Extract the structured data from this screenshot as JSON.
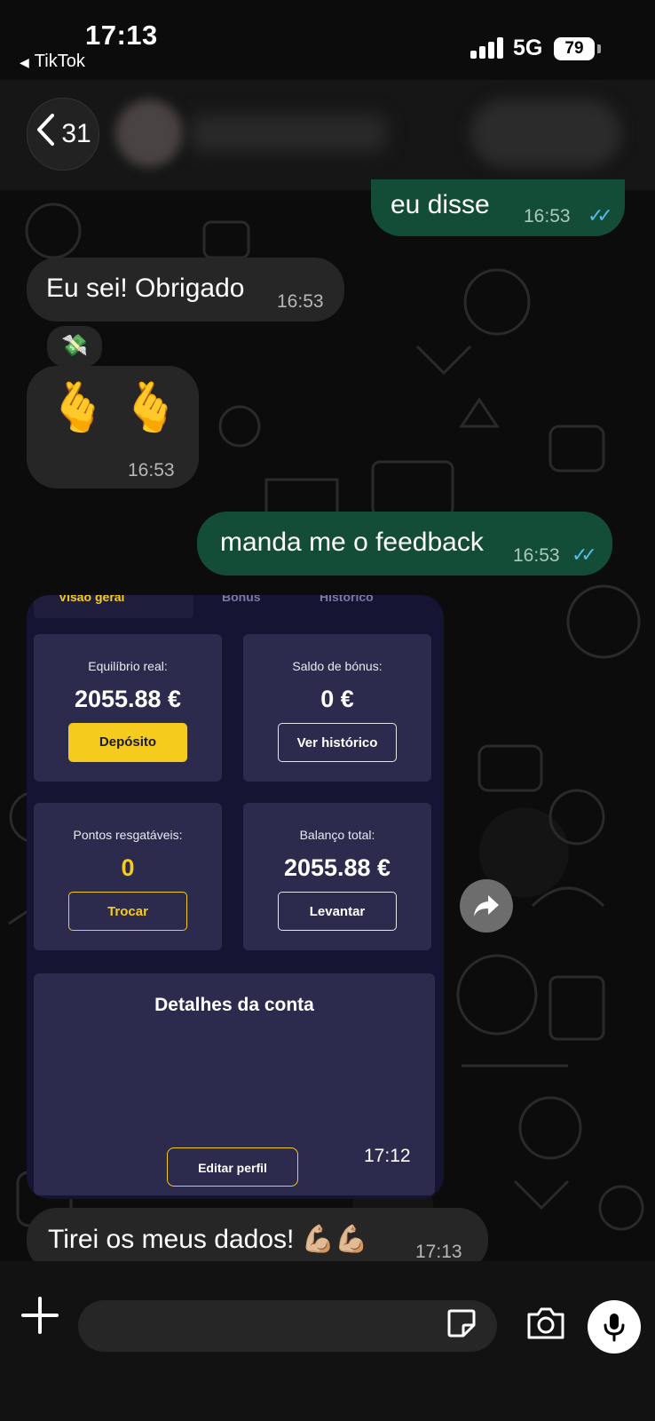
{
  "status_bar": {
    "time": "17:13",
    "back_app": "TikTok",
    "network": "5G",
    "battery": "79"
  },
  "header": {
    "unread_count": "31"
  },
  "messages": [
    {
      "direction": "out",
      "text": "eu disse",
      "time": "16:53"
    },
    {
      "direction": "in",
      "text": "Eu sei! Obrigado",
      "time": "16:53",
      "reaction": "💸"
    },
    {
      "direction": "in",
      "text": "🫰 🫰",
      "time": "16:53"
    },
    {
      "direction": "out",
      "text": "manda me o feedback",
      "time": "16:53"
    },
    {
      "direction": "in",
      "time": "17:12"
    },
    {
      "direction": "in",
      "text": "Tirei os meus dados! 💪🏼💪🏼",
      "time": "17:13"
    }
  ],
  "screenshot": {
    "tabs": [
      "Visão geral",
      "Bónus",
      "Histórico"
    ],
    "cards": [
      {
        "label": "Equilíbrio real:",
        "value": "2055.88 €",
        "button": "Depósito"
      },
      {
        "label": "Saldo de bónus:",
        "value": "0 €",
        "button": "Ver histórico"
      },
      {
        "label": "Pontos resgatáveis:",
        "value": "0",
        "button": "Trocar"
      },
      {
        "label": "Balanço total:",
        "value": "2055.88 €",
        "button": "Levantar"
      }
    ],
    "details_title": "Detalhes da conta",
    "edit_button": "Editar perfil"
  },
  "colors": {
    "outgoing_bubble": "#144d37",
    "incoming_bubble": "#262626",
    "read_ticks": "#53bdeb",
    "accent_yellow": "#f5cc1e"
  },
  "icons": [
    "chevron-left-icon",
    "read-ticks-icon",
    "forward-icon",
    "plus-icon",
    "sticker-icon",
    "camera-icon",
    "mic-icon"
  ]
}
